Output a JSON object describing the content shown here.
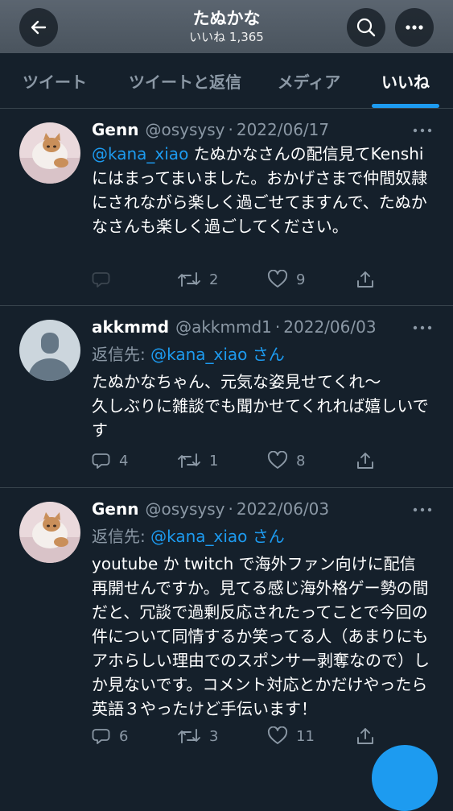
{
  "header": {
    "title": "たぬかな",
    "subtitle": "いいね 1,365"
  },
  "tabs": [
    "ツイート",
    "ツイートと返信",
    "メディア",
    "いいね"
  ],
  "active_tab": 3,
  "colors": {
    "accent": "#1d9bf0",
    "background": "#15202b",
    "secondary_text": "#8b98a5",
    "divider": "#38444d"
  },
  "tweets": [
    {
      "name": "Genn",
      "handle": "@osysysy",
      "dot": "·",
      "date": "2022/06/17",
      "mention": "@kana_xiao",
      "text": " たぬかなさんの配信見てKenshiにはまってまいました。おかげさまで仲間奴隷にされながら楽しく過ごせてますんで、たぬかなさんも楽しく過ごしてください。",
      "replies": "",
      "retweets": "2",
      "likes": "9",
      "avatar": "kitten-avatar"
    },
    {
      "name": "akkmmd",
      "handle": "@akkmmd1",
      "dot": "·",
      "date": "2022/06/03",
      "reply_prefix": "返信先: ",
      "reply_mention": "@kana_xiao",
      "reply_suffix": " さん",
      "text": "たぬかなちゃん、元気な姿見せてくれ〜\n久しぶりに雑談でも聞かせてくれれば嬉しいです",
      "replies": "4",
      "retweets": "1",
      "likes": "8",
      "avatar": "default-avatar"
    },
    {
      "name": "Genn",
      "handle": "@osysysy",
      "dot": "·",
      "date": "2022/06/03",
      "reply_prefix": "返信先: ",
      "reply_mention": "@kana_xiao",
      "reply_suffix": " さん",
      "text": "youtube か twitch で海外ファン向けに配信再開せんですか。見てる感じ海外格ゲー勢の間だと、冗談で過剰反応されたってことで今回の件について同情するか笑ってる人（あまりにもアホらしい理由でのスポンサー剥奪なので）しか見ないです。コメント対応とかだけやったら英語３やったけど手伝います！",
      "replies": "6",
      "retweets": "3",
      "likes": "11",
      "avatar": "kitten-avatar"
    }
  ]
}
